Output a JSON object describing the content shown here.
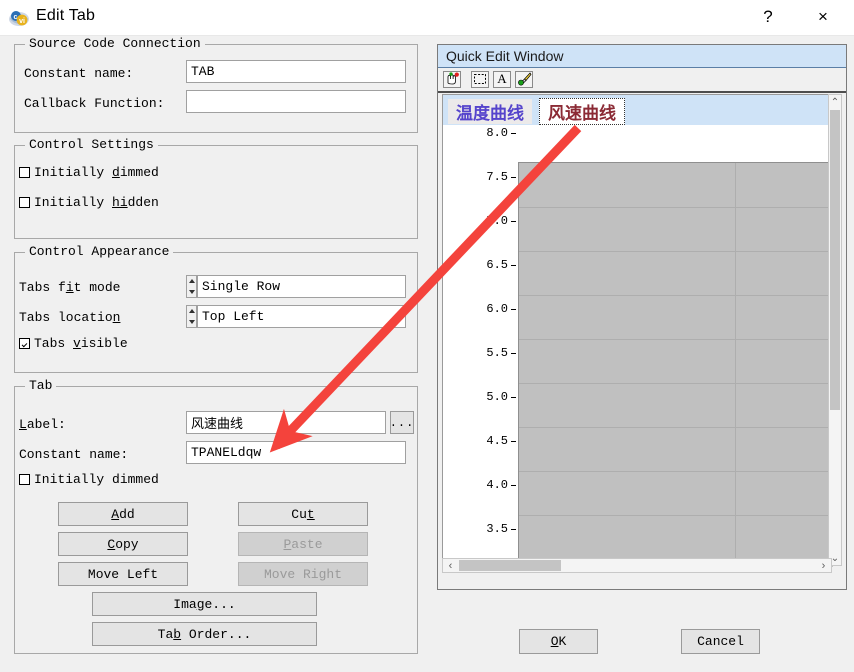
{
  "window": {
    "title": "Edit Tab",
    "icon": "cvi-app-icon",
    "help_label": "?",
    "close_label": "×"
  },
  "source_code_connection": {
    "group_title": "Source Code Connection",
    "constant_name_label": "Constant name:",
    "constant_name_value": "TAB",
    "callback_label": "Callback Function:",
    "callback_value": ""
  },
  "control_settings": {
    "group_title": "Control Settings",
    "initially_dimmed_label": "Initially dimmed",
    "initially_dimmed_checked": false,
    "initially_hidden_label": "Initially hidden",
    "initially_hidden_checked": false
  },
  "control_appearance": {
    "group_title": "Control Appearance",
    "tabs_fit_mode_label": "Tabs fit mode",
    "tabs_fit_mode_value": "Single Row",
    "tabs_location_label": "Tabs location",
    "tabs_location_value": "Top Left",
    "tabs_visible_label": "Tabs visible",
    "tabs_visible_checked": true
  },
  "tab_section": {
    "group_title": "Tab",
    "label_label": "Label:",
    "label_value": "风速曲线",
    "browse_label": "...",
    "constant_name_label": "Constant name:",
    "constant_name_value": "TPANELdqw",
    "initially_dimmed_label": "Initially dimmed",
    "initially_dimmed_checked": false,
    "buttons": {
      "add": "Add",
      "cut": "Cut",
      "copy": "Copy",
      "paste": "Paste",
      "move_left": "Move Left",
      "move_right": "Move Right",
      "image": "Image...",
      "tab_order": "Tab Order..."
    },
    "disabled_buttons": [
      "paste",
      "move_right"
    ]
  },
  "quick_edit": {
    "title": "Quick Edit Window",
    "toolbar_icons": [
      "pointer-hand-icon",
      "select-rectangle-icon",
      "text-tool-icon",
      "paintbrush-icon"
    ],
    "tabs": [
      {
        "label": "温度曲线",
        "selected": false,
        "color": "#5544cc"
      },
      {
        "label": "风速曲线",
        "selected": true,
        "color": "#8b2a35"
      }
    ],
    "scroll": {
      "vertical_up": "⌃",
      "vertical_down": "⌄",
      "horizontal_left": "‹",
      "horizontal_right": "›"
    }
  },
  "chart_data": {
    "type": "line",
    "title": "",
    "xlabel": "",
    "ylabel": "",
    "yticks": [
      "8.0",
      "7.5",
      "7.0",
      "6.5",
      "6.0",
      "5.5",
      "5.0",
      "4.5",
      "4.0",
      "3.5"
    ],
    "ylim": [
      3.5,
      8.0
    ],
    "grid": true,
    "plot_bg": "#c0c0c0",
    "gridline_color": "#aeaeae",
    "series": [],
    "vertical_gridlines": 2,
    "horizontal_gridlines": 9
  },
  "dialog_buttons": {
    "ok": "OK",
    "cancel": "Cancel"
  },
  "annotation": {
    "arrow_color": "#f4433c",
    "from": "quick-edit-tab-fengsu",
    "to": "tab-constant-name-field"
  },
  "colors": {
    "dialog_bg": "#f0f0f0",
    "field_bg": "#ffffff",
    "qew_title_bg": "#cfe3f7",
    "accent_red": "#f4433c"
  }
}
